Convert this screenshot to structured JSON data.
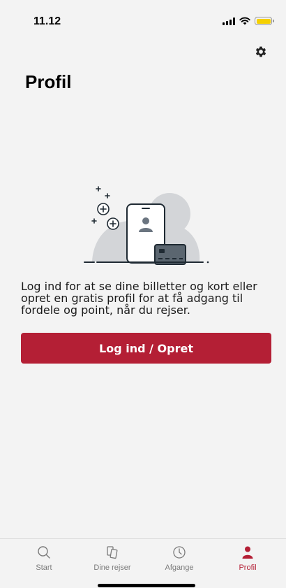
{
  "status_bar": {
    "time": "11.12",
    "icons": [
      "signal-icon",
      "wifi-icon",
      "battery-icon"
    ],
    "battery_color": "#f5d000"
  },
  "header": {
    "settings_icon": "gear-icon",
    "title": "Profil"
  },
  "main": {
    "illustration": "profile-phone-card-illustration",
    "info_text": "Log ind for at se dine billetter og kort eller opret en gratis profil for at få adgang til fordele og point, når du rejser.",
    "login_button_label": "Log ind / Opret"
  },
  "tab_bar": {
    "tabs": [
      {
        "label": "Start",
        "icon": "search-icon",
        "active": false
      },
      {
        "label": "Dine rejser",
        "icon": "tickets-icon",
        "active": false
      },
      {
        "label": "Afgange",
        "icon": "clock-icon",
        "active": false
      },
      {
        "label": "Profil",
        "icon": "person-icon",
        "active": true
      }
    ]
  },
  "colors": {
    "accent": "#b41f35",
    "background": "#f3f3f3",
    "inactive_tab": "#7a7a7a"
  }
}
